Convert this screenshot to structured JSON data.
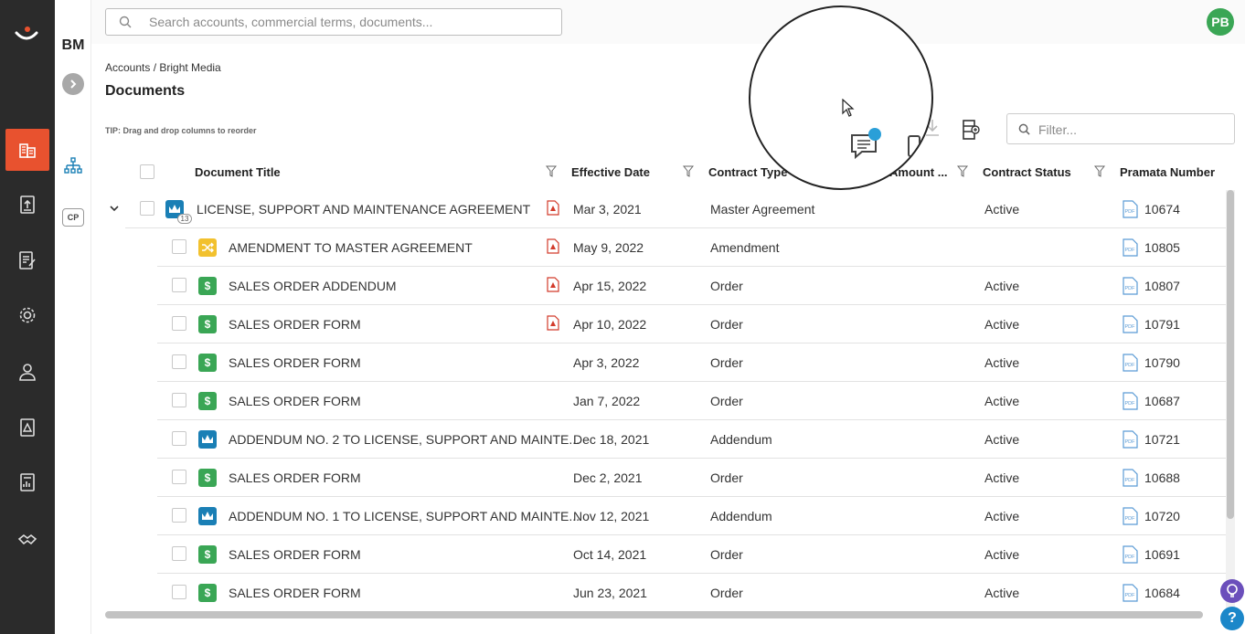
{
  "workspace": {
    "initials": "BM",
    "cp_label": "CP"
  },
  "search": {
    "placeholder": "Search accounts, commercial terms, documents...",
    "value": ""
  },
  "user": {
    "initials": "PB"
  },
  "breadcrumb": "Accounts / Bright Media",
  "page_title": "Documents",
  "tip": "TIP: Drag and drop columns to reorder",
  "filter": {
    "placeholder": "Filter..."
  },
  "columns": {
    "document_title": "Document Title",
    "effective_date": "Effective Date",
    "contract_type": "Contract Type",
    "amount": "Amount ...",
    "contract_status": "Contract Status",
    "pramata_number": "Pramata Number"
  },
  "parent": {
    "title": "LICENSE, SUPPORT AND MAINTENANCE AGREEMENT",
    "child_count": "13",
    "date": "Mar 3, 2021",
    "type": "Master Agreement",
    "status": "Active",
    "number": "10674",
    "icon": "crown-icon",
    "flag": true
  },
  "rows": [
    {
      "title": "AMENDMENT TO MASTER AGREEMENT",
      "date": "May 9, 2022",
      "type": "Amendment",
      "status": "",
      "number": "10805",
      "icon": "shuffle-icon",
      "flag": true
    },
    {
      "title": "SALES ORDER ADDENDUM",
      "date": "Apr 15, 2022",
      "type": "Order",
      "status": "Active",
      "number": "10807",
      "icon": "dollar-icon",
      "flag": true
    },
    {
      "title": "SALES ORDER FORM",
      "date": "Apr 10, 2022",
      "type": "Order",
      "status": "Active",
      "number": "10791",
      "icon": "dollar-icon",
      "flag": true
    },
    {
      "title": "SALES ORDER FORM",
      "date": "Apr 3, 2022",
      "type": "Order",
      "status": "Active",
      "number": "10790",
      "icon": "dollar-icon",
      "flag": false
    },
    {
      "title": "SALES ORDER FORM",
      "date": "Jan 7, 2022",
      "type": "Order",
      "status": "Active",
      "number": "10687",
      "icon": "dollar-icon",
      "flag": false
    },
    {
      "title": "ADDENDUM NO. 2 TO LICENSE, SUPPORT AND MAINTE...",
      "date": "Dec 18, 2021",
      "type": "Addendum",
      "status": "Active",
      "number": "10721",
      "icon": "crown-icon",
      "flag": false
    },
    {
      "title": "SALES ORDER FORM",
      "date": "Dec 2, 2021",
      "type": "Order",
      "status": "Active",
      "number": "10688",
      "icon": "dollar-icon",
      "flag": false
    },
    {
      "title": "ADDENDUM NO. 1 TO LICENSE, SUPPORT AND MAINTE...",
      "date": "Nov 12, 2021",
      "type": "Addendum",
      "status": "Active",
      "number": "10720",
      "icon": "crown-icon",
      "flag": false
    },
    {
      "title": "SALES ORDER FORM",
      "date": "Oct 14, 2021",
      "type": "Order",
      "status": "Active",
      "number": "10691",
      "icon": "dollar-icon",
      "flag": false
    },
    {
      "title": "SALES ORDER FORM",
      "date": "Jun 23, 2021",
      "type": "Order",
      "status": "Active",
      "number": "10684",
      "icon": "dollar-icon",
      "flag": false
    }
  ],
  "colors": {
    "accent": "#e8522f",
    "crown": "#1a7fb5",
    "dollar": "#3aa655",
    "shuffle": "#f2c12e",
    "avatar": "#3aa655"
  }
}
